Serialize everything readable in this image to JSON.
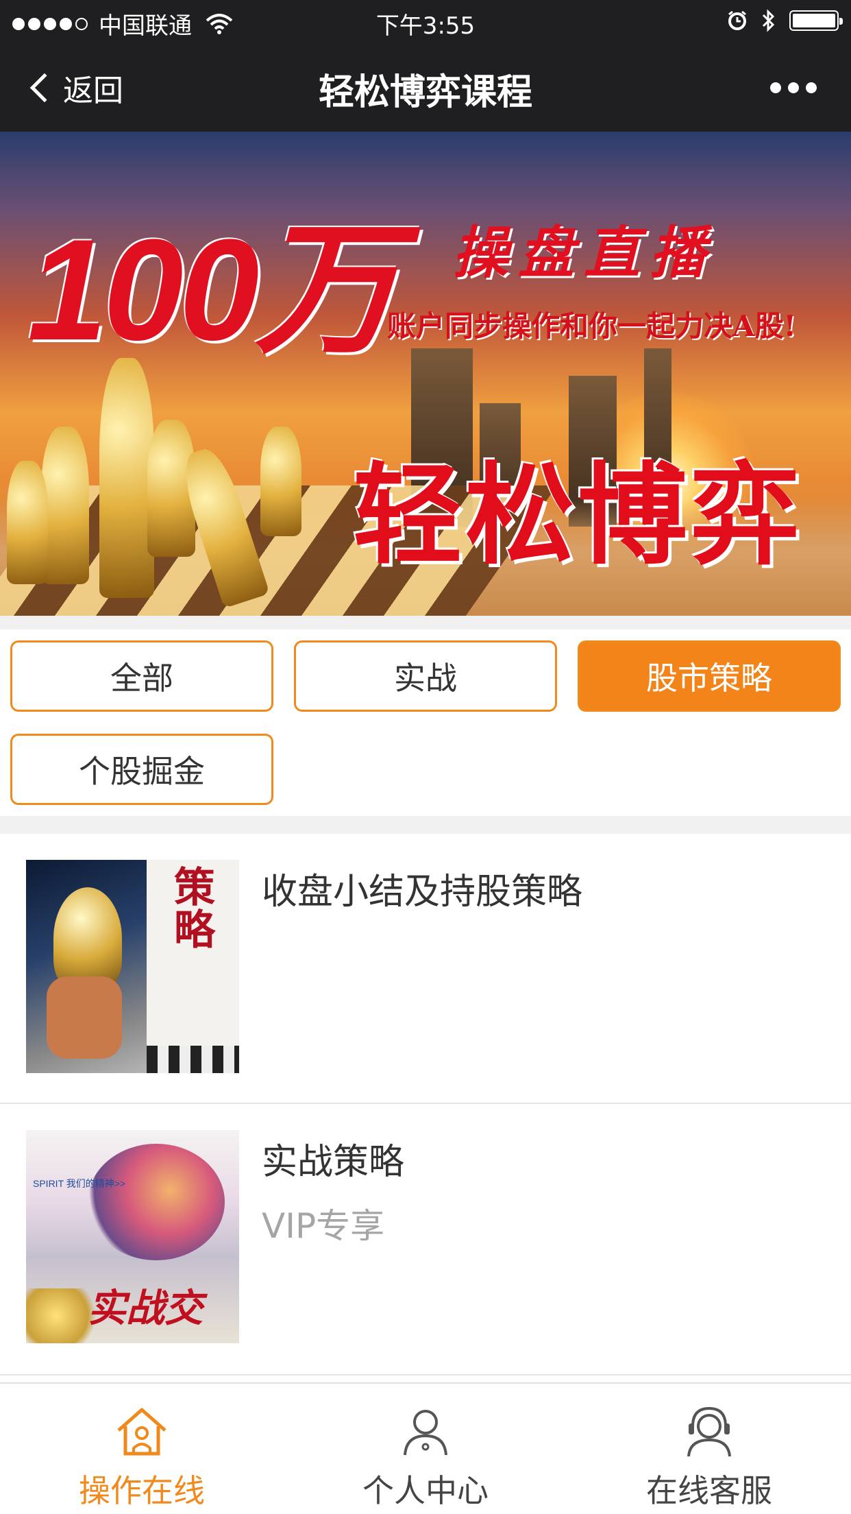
{
  "status_bar": {
    "carrier": "中国联通",
    "time": "下午3:55",
    "signal_bars_filled": 4,
    "signal_bars_total": 5,
    "battery_level": 1.0
  },
  "nav": {
    "back_label": "返回",
    "title": "轻松博弈课程"
  },
  "banner": {
    "headline_amount": "100万",
    "headline_live": "操盘直播",
    "slogan": "账户同步操作和你一起力决A股!",
    "brand": "轻松博弈",
    "current_slide": 1,
    "slide_count": 2
  },
  "filters": [
    {
      "label": "全部",
      "active": false
    },
    {
      "label": "实战",
      "active": false
    },
    {
      "label": "股市策略",
      "active": true
    },
    {
      "label": "个股掘金",
      "active": false
    }
  ],
  "courses": [
    {
      "title": "收盘小结及持股策略",
      "subtitle": "",
      "thumb_text": "策略"
    },
    {
      "title": "实战策略",
      "subtitle": "VIP专享",
      "thumb_text": "实战交易",
      "thumb_caption": "SPIRIT 我们的精神>>"
    }
  ],
  "tabbar": {
    "items": [
      {
        "label": "操作在线",
        "icon": "home-icon",
        "active": true
      },
      {
        "label": "个人中心",
        "icon": "user-icon",
        "active": false
      },
      {
        "label": "在线客服",
        "icon": "headset-icon",
        "active": false
      }
    ],
    "active_color": "#f08a1c"
  },
  "colors": {
    "accent": "#f2841a",
    "nav_bg": "#1f1f21",
    "pager_active": "#2f7bd8"
  }
}
